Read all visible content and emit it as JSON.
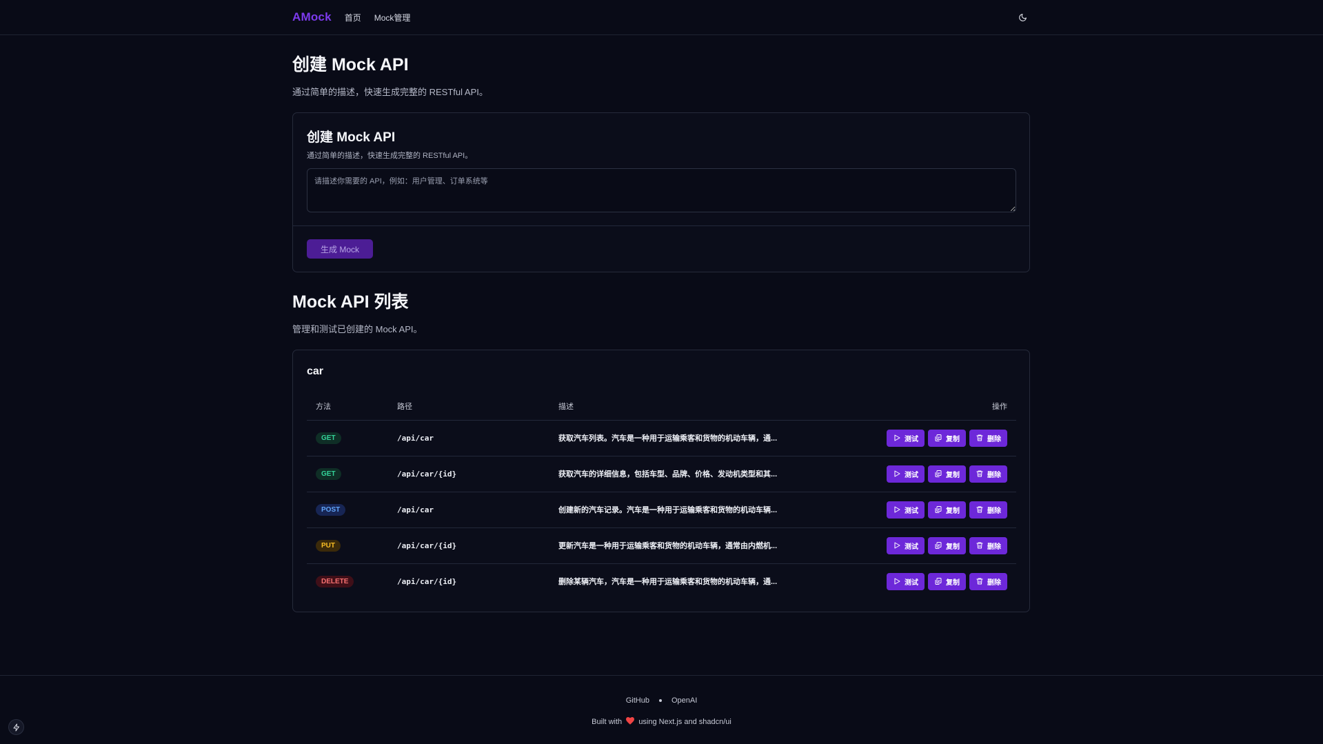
{
  "header": {
    "brand": "AMock",
    "nav": [
      {
        "label": "首页"
      },
      {
        "label": "Mock管理"
      }
    ],
    "theme_icon": "moon-icon"
  },
  "create_section": {
    "title": "创建 Mock API",
    "subtitle": "通过简单的描述，快速生成完整的 RESTful API。",
    "card": {
      "title": "创建 Mock API",
      "description": "通过简单的描述，快速生成完整的 RESTful API。",
      "textarea_placeholder": "请描述你需要的 API，例如：用户管理、订单系统等",
      "textarea_value": "",
      "button_label": "生成 Mock"
    }
  },
  "list_section": {
    "title": "Mock API 列表",
    "subtitle": "管理和测试已创建的 Mock API。",
    "group": {
      "name": "car",
      "columns": {
        "method": "方法",
        "path": "路径",
        "description": "描述",
        "actions": "操作"
      },
      "rows": [
        {
          "method": "GET",
          "path": "/api/car",
          "description": "获取汽车列表。汽车是一种用于运输乘客和货物的机动车辆，通..."
        },
        {
          "method": "GET",
          "path": "/api/car/{id}",
          "description": "获取汽车的详细信息，包括车型、品牌、价格、发动机类型和其..."
        },
        {
          "method": "POST",
          "path": "/api/car",
          "description": "创建新的汽车记录。汽车是一种用于运输乘客和货物的机动车辆..."
        },
        {
          "method": "PUT",
          "path": "/api/car/{id}",
          "description": "更新汽车是一种用于运输乘客和货物的机动车辆，通常由内燃机..."
        },
        {
          "method": "DELETE",
          "path": "/api/car/{id}",
          "description": "删除某辆汽车，汽车是一种用于运输乘客和货物的机动车辆，通..."
        }
      ],
      "actions": {
        "test": "测试",
        "copy": "复制",
        "delete": "删除"
      }
    }
  },
  "method_colors": {
    "GET": {
      "bg": "#0f2e26",
      "fg": "#34d399"
    },
    "POST": {
      "bg": "#172554",
      "fg": "#60a5fa"
    },
    "PUT": {
      "bg": "#3b2a0a",
      "fg": "#fbbf24"
    },
    "DELETE": {
      "bg": "#3f0f18",
      "fg": "#f87171"
    }
  },
  "footer": {
    "links": [
      {
        "label": "GitHub"
      },
      {
        "label": "OpenAI"
      }
    ],
    "built_prefix": "Built with",
    "built_suffix": "using Next.js and shadcn/ui",
    "heart_icon": "heart-icon"
  },
  "colors": {
    "accent": "#6d28d9",
    "brand": "#7c3aed",
    "background": "#090b17"
  }
}
